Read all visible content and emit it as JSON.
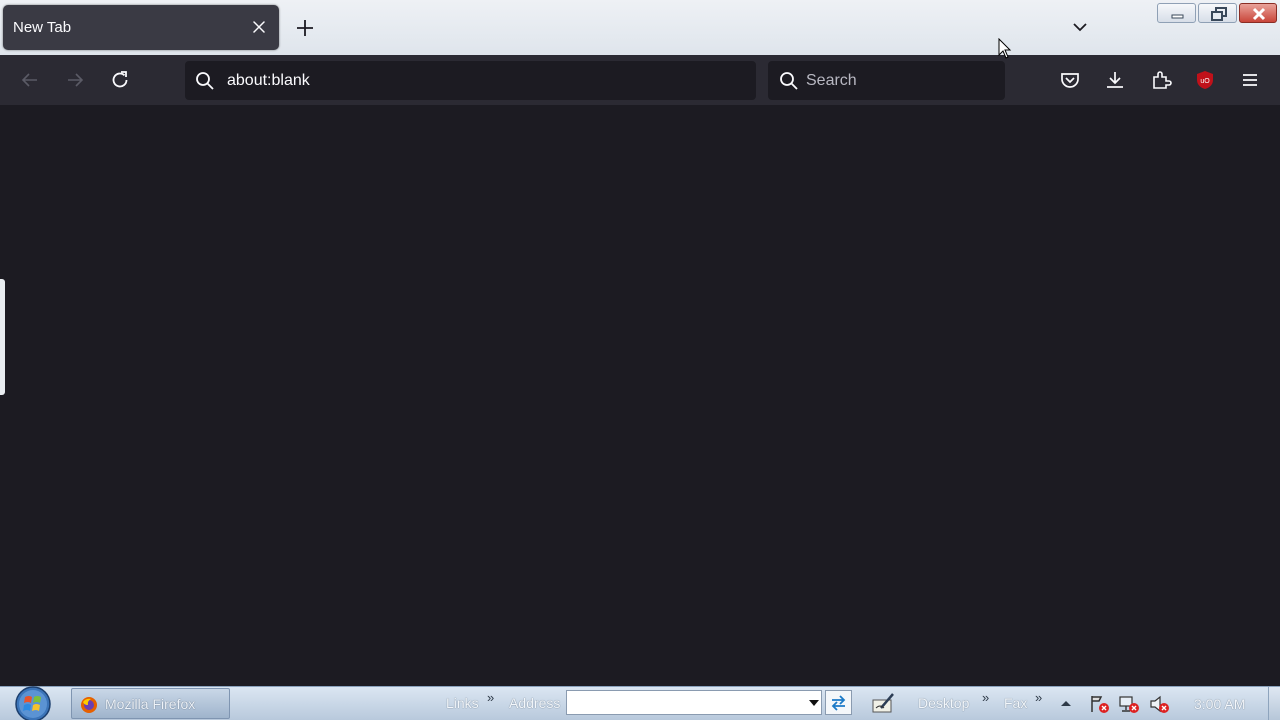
{
  "tab": {
    "title": "New Tab"
  },
  "navbar": {
    "url": "about:blank",
    "search_placeholder": "Search"
  },
  "taskbar": {
    "task_button_label": "Mozilla Firefox",
    "links_label": "Links",
    "address_label": "Address",
    "address_value": "",
    "desktop_label": "Desktop",
    "fax_label": "Fax",
    "clock": "3:00 AM"
  },
  "colors": {
    "content_bg": "#1c1b22",
    "toolbar_bg": "#2b2a33",
    "tab_bg": "#3a3a44",
    "ublock_red": "#c0111a"
  },
  "icons": [
    "close-icon",
    "plus-icon",
    "chevron-down-icon",
    "minimize-icon",
    "restore-icon",
    "window-close-icon",
    "back-arrow-icon",
    "forward-arrow-icon",
    "reload-icon",
    "search-icon",
    "pocket-icon",
    "download-icon",
    "extensions-icon",
    "ublock-origin-icon",
    "hamburger-menu-icon",
    "windows-start-icon",
    "firefox-icon"
  ]
}
